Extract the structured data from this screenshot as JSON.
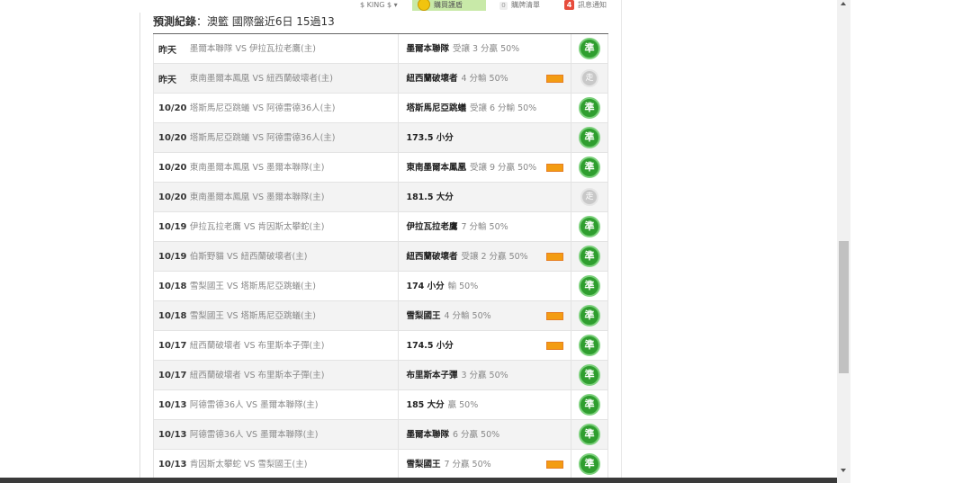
{
  "topbar": {
    "king": "$ KING $ ▾",
    "buy": "購買護盾",
    "cart_count": "0",
    "cart_label": "購牌清單",
    "msg_count": "4",
    "msg_label": "訊息通知"
  },
  "heading": {
    "prefix": "預測紀錄",
    "rest": "：澳籃 國際盤近6日 15過13"
  },
  "rows": [
    {
      "date": "昨天",
      "match": "墨爾本聯隊 VS 伊拉瓦拉老鷹(主)",
      "team": "墨爾本聯隊",
      "detail": "受讓 3 分贏 50%",
      "badge": false,
      "result": "準"
    },
    {
      "date": "昨天",
      "match": "東南墨爾本鳳凰 VS 紐西蘭破壞者(主)",
      "team": "紐西蘭破壞者",
      "detail": "4 分輸 50%",
      "badge": true,
      "result": "走"
    },
    {
      "date": "10/20",
      "match": "塔斯馬尼亞跳蟻 VS 阿德雷德36人(主)",
      "team": "塔斯馬尼亞跳蟻",
      "detail": "受讓 6 分輸 50%",
      "badge": false,
      "result": "準"
    },
    {
      "date": "10/20",
      "match": "塔斯馬尼亞跳蟻 VS 阿德雷德36人(主)",
      "team": "173.5 小分",
      "detail": "",
      "badge": false,
      "result": "準"
    },
    {
      "date": "10/20",
      "match": "東南墨爾本鳳凰 VS 墨爾本聯隊(主)",
      "team": "東南墨爾本鳳凰",
      "detail": "受讓 9 分贏 50%",
      "badge": true,
      "result": "準"
    },
    {
      "date": "10/20",
      "match": "東南墨爾本鳳凰 VS 墨爾本聯隊(主)",
      "team": "181.5 大分",
      "detail": "",
      "badge": false,
      "result": "走"
    },
    {
      "date": "10/19",
      "match": "伊拉瓦拉老鷹 VS 肯因斯太攀蛇(主)",
      "team": "伊拉瓦拉老鷹",
      "detail": "7 分輸 50%",
      "badge": false,
      "result": "準"
    },
    {
      "date": "10/19",
      "match": "伯斯野貓 VS 紐西蘭破壞者(主)",
      "team": "紐西蘭破壞者",
      "detail": "受讓 2 分贏 50%",
      "badge": true,
      "result": "準"
    },
    {
      "date": "10/18",
      "match": "雪梨國王 VS 塔斯馬尼亞跳蟻(主)",
      "team": "174 小分",
      "detail": "輸 50%",
      "badge": false,
      "result": "準"
    },
    {
      "date": "10/18",
      "match": "雪梨國王 VS 塔斯馬尼亞跳蟻(主)",
      "team": "雪梨國王",
      "detail": "4 分輸 50%",
      "badge": true,
      "result": "準"
    },
    {
      "date": "10/17",
      "match": "紐西蘭破壞者 VS 布里斯本子彈(主)",
      "team": "174.5 小分",
      "detail": "",
      "badge": true,
      "result": "準"
    },
    {
      "date": "10/17",
      "match": "紐西蘭破壞者 VS 布里斯本子彈(主)",
      "team": "布里斯本子彈",
      "detail": "3 分贏 50%",
      "badge": false,
      "result": "準"
    },
    {
      "date": "10/13",
      "match": "阿德雷德36人 VS 墨爾本聯隊(主)",
      "team": "185 大分",
      "detail": "贏 50%",
      "badge": false,
      "result": "準"
    },
    {
      "date": "10/13",
      "match": "阿德雷德36人 VS 墨爾本聯隊(主)",
      "team": "墨爾本聯隊",
      "detail": "6 分贏 50%",
      "badge": false,
      "result": "準"
    },
    {
      "date": "10/13",
      "match": "肯因斯太攀蛇 VS 雪梨國王(主)",
      "team": "雪梨國王",
      "detail": "7 分贏 50%",
      "badge": true,
      "result": "準"
    }
  ]
}
